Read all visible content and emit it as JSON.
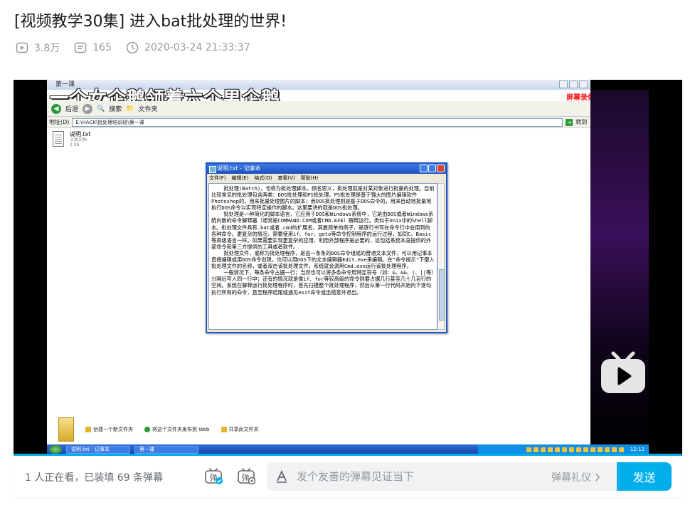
{
  "video": {
    "title": "[视频教学30集] 进入bat批处理的世界!",
    "views": "3.8万",
    "danmaku_count": "165",
    "publish_time": "2020-03-24 21:33:37"
  },
  "player": {
    "window_title": "第一课",
    "caption": "一个女企鹅领着六个男企鹅",
    "watermark": "屏幕录像专家 未注册",
    "toolbar": {
      "back": "后退",
      "search": "搜索",
      "folders": "文件夹"
    },
    "address": {
      "label": "地址(D)",
      "path": "E:\\HACK\\批处理培训班\\第一课",
      "go": "转到"
    },
    "file": {
      "name": "说明.txt",
      "type": "文本文档",
      "size": "2 KB"
    },
    "notepad": {
      "title": "说明.txt - 记事本",
      "menu": [
        "文件(F)",
        "编辑(E)",
        "格式(O)",
        "查看(V)",
        "帮助(H)"
      ],
      "text": "    批处理(Batch)，也称为批处理脚本。顾名思义，批处理就是对某对象进行批量的处理。目前比较常见的批处理包含两类：DOS批处理和PS批处理。PS批处理是基于强大的图片编辑软件Photoshop的，用来批量处理图片的脚本；而DOS批处理则是基于DOS命令的，用来自动地批量地执行DOS命令以实现特定操作的脚本。这里要讲的就是DOS批处理。\n    批处理是一种简化的脚本语言，它应用于DOS和Windows系统中，它是由DOS或者Windows系统内嵌的命令解释器（通常是COMMAND.COM或者CMD.EXE）解释运行。类似于Unix中的Shell脚本。批处理文件具有.bat或者.cmd的扩展名，其最简单的例子，是逐行书写在命令行中会用到的各种命令。更复杂的情况，需要使用if、for、goto等命令控制程序的运行过程，如同C、Basic等高级语言一样。如果需要实现更复杂的应用，利用外部程序是必要的，这包括系统本身提供的外部命令和第三方提供的工具或者软件。\n    批处理文件，或称为批处理程序，是由一条条的DOS命令组成的普通文本文件，可以用记事本直接编辑或用DOS命令创建，也可以用DOS下的文本编辑器Edit.exe来编辑。在\"命令提示\"下键入批处理文件的名称，或者双击该批处理文件，系统就会调用Cmd.exe运行该批处理程序。\n    一般情况下，每条命令占据一行；当然也可以将多条命令用特定符号（如：&、&&、|、||等）分隔后写入同一行中；还有的情况就是像if、for等较高级的命令则要占据几行甚至几十几百行的空间。系统在解释运行批处理程序时，首先扫描整个批处理程序，然后从第一行代码开始向下逐句执行所有的命令，直至程序结尾或遇见exit命令或出错意外退出。"
    },
    "bottom_links": [
      "创建一个新文件夹",
      "将这个文件夹发布到 Web",
      "共享此文件夹"
    ],
    "taskbar": {
      "task1": "说明.txt - 记事本",
      "task2": "第一课",
      "clock": "12:12"
    }
  },
  "danmaku": {
    "viewers_text": "1 人正在看，已装填 69 条弹幕",
    "placeholder": "发个友善的弹幕见证当下",
    "gift_label": "弹幕礼仪",
    "send_label": "发送"
  },
  "colors": {
    "accent": "#00aeec",
    "meta_gray": "#9499a0",
    "title": "#18191c"
  }
}
